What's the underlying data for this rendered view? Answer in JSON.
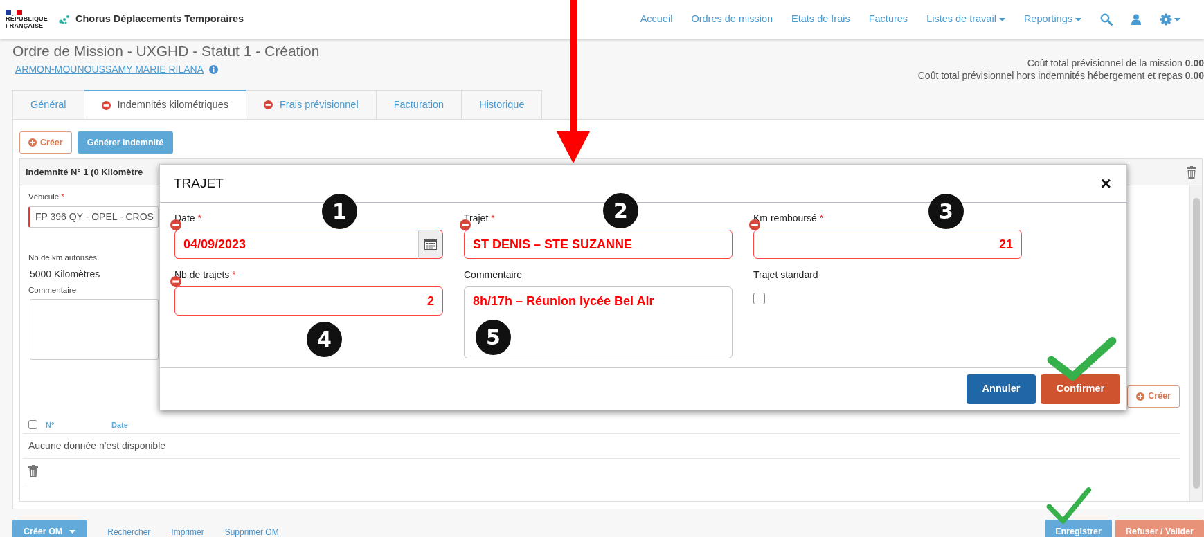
{
  "header": {
    "logo_lines": [
      "RÉPUBLIQUE",
      "FRANÇAISE"
    ],
    "app_name": "Chorus Déplacements Temporaires",
    "nav": [
      {
        "label": "Accueil",
        "kind": "link"
      },
      {
        "label": "Ordres de mission",
        "kind": "link"
      },
      {
        "label": "Etats de frais",
        "kind": "link"
      },
      {
        "label": "Factures",
        "kind": "link"
      },
      {
        "label": "Listes de travail",
        "kind": "dropdown"
      },
      {
        "label": "Reportings",
        "kind": "dropdown"
      }
    ]
  },
  "page": {
    "title": "Ordre de Mission - UXGHD - Statut 1 - Création",
    "person": "ARMON-MOUNOUSSAMY MARIE RILANA",
    "costs": [
      "Coût total prévisionnel de la mission **0.00**",
      "Coût total prévisionnel hors indemnités hébergement et repas **0.00**"
    ]
  },
  "tabs": [
    {
      "label": "Général",
      "selected": false,
      "error": false
    },
    {
      "label": "Indemnités kilométriques",
      "selected": true,
      "error": true
    },
    {
      "label": "Frais prévisionnel",
      "selected": false,
      "error": true
    },
    {
      "label": "Facturation",
      "selected": false,
      "error": false
    },
    {
      "label": "Historique",
      "selected": false,
      "error": false
    }
  ],
  "toolbar": [
    {
      "label": "Créer",
      "kind": "create"
    },
    {
      "label": "Générer indemnité",
      "kind": "generate"
    }
  ],
  "indemnity": {
    "title": "Indemnité N° 1 (0 Kilomètre",
    "select_all_checked": false,
    "vehicle": {
      "label": "Véhicule",
      "required_mark": "*",
      "value": "FP 396 QY - OPEL - CROS",
      "invalid": true
    },
    "km_label": "Nb de km autorisés",
    "km_value": "5000 Kilomètres",
    "comment_label": "Commentaire",
    "create_button": "Créer",
    "columns": [
      "N°",
      "Date"
    ],
    "empty_text": "Aucune donnée n'est disponible"
  },
  "modal": {
    "title": "TRAJET",
    "close": "×",
    "fields": [
      {
        "label": "Date",
        "required_mark": "*",
        "kind": "date",
        "value": "04/09/2023",
        "invalid": true,
        "marker": "1"
      },
      {
        "label": "Trajet",
        "required_mark": "*",
        "kind": "text",
        "value": "ST DENIS – STE SUZANNE",
        "invalid": true,
        "marker": "2"
      },
      {
        "label": "Km remboursé",
        "required_mark": "*",
        "kind": "number",
        "value": "21",
        "invalid": true,
        "marker": "3"
      },
      {
        "label": "Nb de trajets",
        "required_mark": "*",
        "kind": "number",
        "value": "2",
        "invalid": true,
        "marker": "4"
      },
      {
        "label": "Commentaire",
        "kind": "textarea",
        "value": "8h/17h – Réunion lycée Bel Air",
        "invalid": false,
        "marker": "5"
      },
      {
        "label": "Trajet standard",
        "kind": "checkbox",
        "checked": false
      }
    ],
    "buttons": [
      {
        "label": "Annuler",
        "kind": "cancel",
        "checkmark": false
      },
      {
        "label": "Confirmer",
        "kind": "confirm",
        "checkmark": true
      }
    ]
  },
  "footer": {
    "menu_button": "Créer OM",
    "links": [
      "Rechercher",
      "Imprimer",
      "Supprimer OM"
    ],
    "buttons": [
      {
        "label": "Enregistrer",
        "kind": "save",
        "checkmark": true
      },
      {
        "label": "Refuser / Valider",
        "kind": "reject",
        "checkmark": false
      }
    ]
  },
  "annotations": {
    "arrow": true
  }
}
